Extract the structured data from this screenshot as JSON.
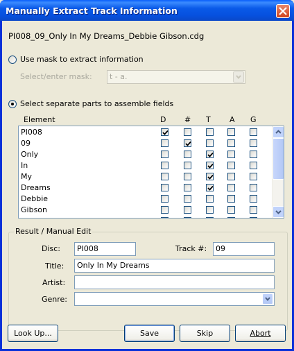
{
  "window": {
    "title": "Manually Extract Track Information"
  },
  "filename": "PI008_09_Only In My Dreams_Debbie Gibson.cdg",
  "mask_option": {
    "label": "Use mask to extract information",
    "selected": false,
    "mask_label": "Select/enter mask:",
    "mask_value": "t - a."
  },
  "parts_option": {
    "label": "Select separate parts to assemble fields",
    "selected": true
  },
  "grid": {
    "headers": [
      "Element",
      "D",
      "#",
      "T",
      "A",
      "G"
    ],
    "rows": [
      {
        "element": "PI008",
        "checks": [
          true,
          false,
          false,
          false,
          false
        ]
      },
      {
        "element": "09",
        "checks": [
          false,
          true,
          false,
          false,
          false
        ]
      },
      {
        "element": "Only",
        "checks": [
          false,
          false,
          true,
          false,
          false
        ]
      },
      {
        "element": "In",
        "checks": [
          false,
          false,
          true,
          false,
          false
        ]
      },
      {
        "element": "My",
        "checks": [
          false,
          false,
          true,
          false,
          false
        ]
      },
      {
        "element": "Dreams",
        "checks": [
          false,
          false,
          true,
          false,
          false
        ]
      },
      {
        "element": "Debbie",
        "checks": [
          false,
          false,
          false,
          false,
          false
        ]
      },
      {
        "element": "Gibson",
        "checks": [
          false,
          false,
          false,
          false,
          false
        ]
      },
      {
        "element": "cdg",
        "checks": [
          false,
          false,
          false,
          false,
          false
        ]
      }
    ]
  },
  "result": {
    "group_title": "Result / Manual Edit",
    "disc_label": "Disc:",
    "disc_value": "PI008",
    "track_label": "Track #:",
    "track_value": "09",
    "title_label": "Title:",
    "title_value": "Only In My Dreams",
    "artist_label": "Artist:",
    "artist_value": "",
    "genre_label": "Genre:",
    "genre_value": ""
  },
  "buttons": {
    "lookup": "Look Up...",
    "save": "Save",
    "skip": "Skip",
    "abort": "Abort"
  }
}
